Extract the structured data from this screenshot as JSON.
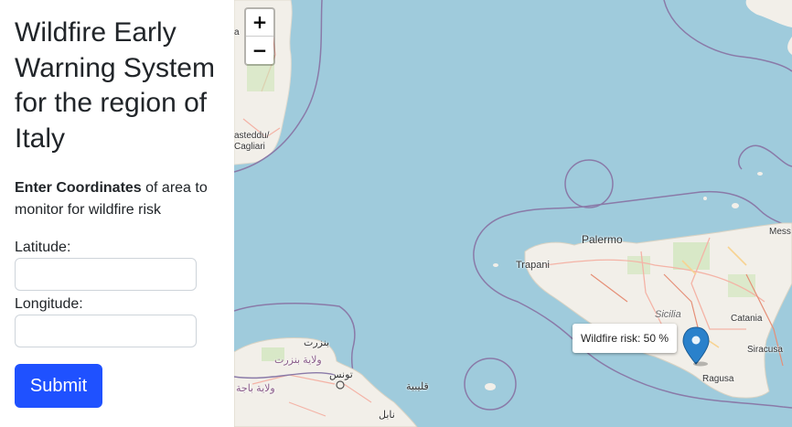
{
  "sidebar": {
    "title": "Wildfire Early Warning System for the region of Italy",
    "intro_bold": "Enter Coordinates",
    "intro_rest": " of area to monitor for wildfire risk",
    "latitude_label": "Latitude:",
    "latitude_value": "",
    "longitude_label": "Longitude:",
    "longitude_value": "",
    "submit_label": "Submit",
    "submit_color": "#1f51ff"
  },
  "map": {
    "zoom_in_label": "+",
    "zoom_out_label": "−",
    "tooltip": "Wildfire risk: 50 %",
    "marker_color": "#2a81cb",
    "sea_color": "#9fcbdc",
    "land_color": "#f2efe9",
    "labels": {
      "palermo": "Palermo",
      "trapani": "Trapani",
      "sicilia": "Sicilia",
      "catania": "Catania",
      "siracusa": "Siracusa",
      "ragusa": "Ragusa",
      "messina": "Mess",
      "cagliari": "asteddu/\nCagliari",
      "cagliari_top": "a",
      "bizerte": "بنزرت",
      "bizerte_gov": "ولاية بنزرت",
      "tunis": "تونس",
      "beja_gov": "ولاية باجة",
      "kelibia": "قليبية",
      "nabeul": "نابل"
    }
  }
}
